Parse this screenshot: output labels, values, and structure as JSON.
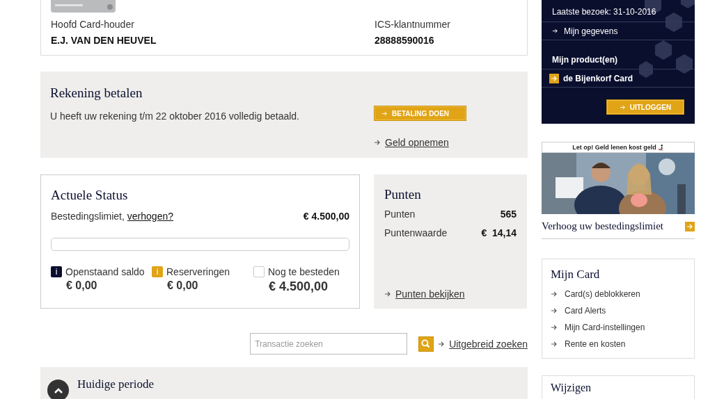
{
  "card_holder": {
    "fields": [
      {
        "label": "Hoofd Card-houder",
        "value": "E.J. VAN DEN HEUVEL"
      },
      {
        "label": "ICS-klantnummer",
        "value": "28888590016"
      }
    ]
  },
  "payment": {
    "title": "Rekening betalen",
    "text": "U heeft uw rekening t/m 22 oktober 2016 volledig betaald.",
    "button": "BETALING DOEN",
    "link": "Geld opnemen"
  },
  "status": {
    "title": "Actuele Status",
    "limit_label": "Bestedingslimiet,",
    "limit_link": "verhogen?",
    "limit_value": "€ 4.500,00",
    "legend": [
      {
        "icon": "i",
        "label": "Openstaand saldo",
        "value": "€ 0,00",
        "color": "#0a0f2e"
      },
      {
        "icon": "i",
        "label": "Reserveringen",
        "value": "€ 0,00",
        "color": "#e0a416"
      },
      {
        "label": "Nog te besteden",
        "value": "€ 4.500,00",
        "color": "#ffffff"
      }
    ]
  },
  "points": {
    "title": "Punten",
    "rows": [
      {
        "label": "Punten",
        "value": "565"
      },
      {
        "label": "Puntenwaarde",
        "value": "€  14,14"
      }
    ],
    "link": "Punten bekijken"
  },
  "search": {
    "placeholder": "Transactie zoeken",
    "link": "Uitgebreid zoeken"
  },
  "period": {
    "title": "Huidige periode"
  },
  "account": {
    "last_visit": "Laatste bezoek: 31-10-2016",
    "link": "Mijn gegevens",
    "products_title": "Mijn product(en)",
    "product": "de Bijenkorf Card",
    "logout": "UITLOGGEN"
  },
  "ad": {
    "notice": "Let op! Geld lenen kost geld",
    "heading": "Verhoog uw bestedingslimiet"
  },
  "my_card": {
    "title": "Mijn Card",
    "links": [
      "Card(s) deblokkeren",
      "Card Alerts",
      "Mijn Card-instellingen",
      "Rente en kosten"
    ]
  },
  "change": {
    "title": "Wijzigen"
  }
}
